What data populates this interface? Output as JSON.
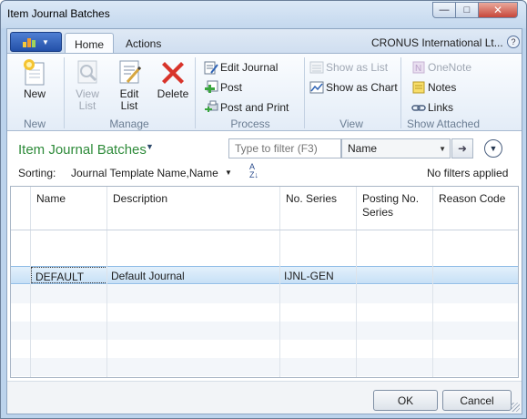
{
  "window": {
    "title": "Item Journal Batches",
    "min_glyph": "—",
    "max_glyph": "□",
    "close_glyph": "✕"
  },
  "ribbon": {
    "tabs": [
      "Home",
      "Actions"
    ],
    "company": "CRONUS International Lt...",
    "help_glyph": "?",
    "groups": {
      "new": {
        "label": "New",
        "buttons": {
          "new": "New"
        }
      },
      "manage": {
        "label": "Manage",
        "buttons": {
          "view_list": "View\nList",
          "edit_list": "Edit\nList",
          "delete": "Delete"
        }
      },
      "process": {
        "label": "Process",
        "buttons": {
          "edit_journal": "Edit Journal",
          "post": "Post",
          "post_and_print": "Post and Print"
        }
      },
      "view": {
        "label": "View",
        "buttons": {
          "show_as_list": "Show as List",
          "show_as_chart": "Show as Chart"
        }
      },
      "show_attached": {
        "label": "Show Attached",
        "buttons": {
          "onenote": "OneNote",
          "notes": "Notes",
          "links": "Links"
        }
      }
    }
  },
  "page": {
    "title": "Item Journal Batches",
    "filter_placeholder": "Type to filter (F3)",
    "filter_field": "Name",
    "sorting_label": "Sorting:",
    "sorting_value": "Journal Template Name,Name",
    "no_filters": "No filters applied"
  },
  "grid": {
    "columns": [
      "Name",
      "Description",
      "No. Series",
      "Posting No. Series",
      "Reason Code"
    ],
    "rows": [
      {
        "name": "DEFAULT",
        "description": "Default Journal",
        "no_series": "IJNL-GEN",
        "posting_no_series": "",
        "reason_code": ""
      }
    ]
  },
  "footer": {
    "ok": "OK",
    "cancel": "Cancel"
  },
  "colors": {
    "title_green": "#2e8b3a",
    "selected_row": "#c7e0f6",
    "close_red": "#c7473a"
  }
}
